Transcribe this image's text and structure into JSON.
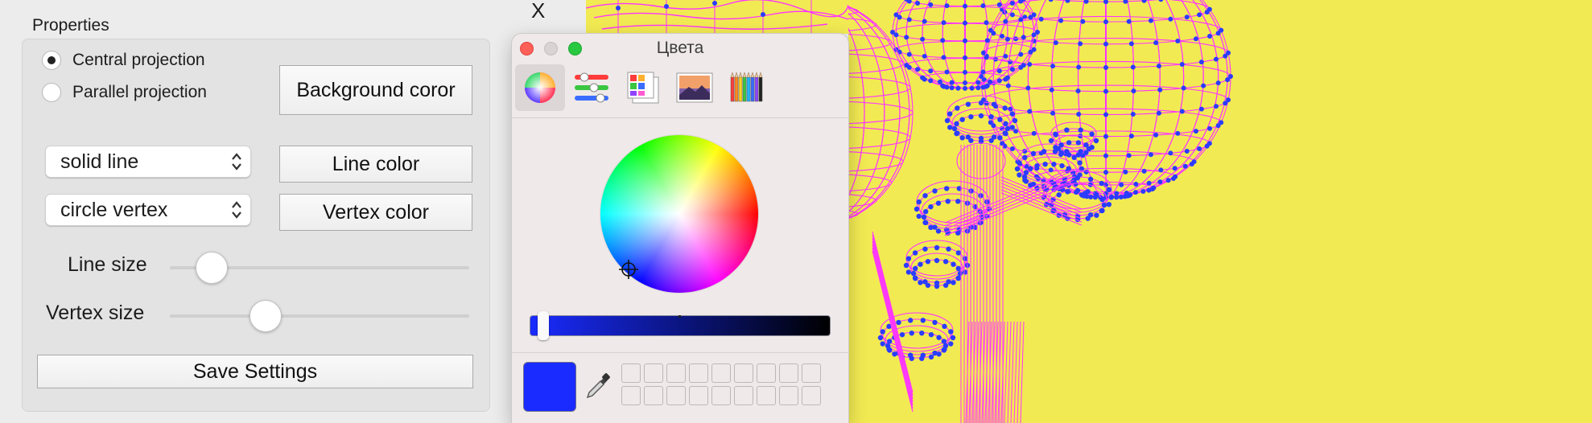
{
  "window": {
    "title": "Properties",
    "close_label": "X"
  },
  "projection": {
    "options": [
      {
        "label": "Central projection",
        "selected": true
      },
      {
        "label": "Parallel projection",
        "selected": false
      }
    ]
  },
  "buttons": {
    "background": "Background coror",
    "line_color": "Line color",
    "vertex_color": "Vertex color",
    "save": "Save Settings"
  },
  "combos": {
    "line_type": "solid line",
    "vertex_type": "circle vertex"
  },
  "sliders": {
    "line_size": {
      "label": "Line size",
      "value_fraction": 0.14
    },
    "vertex_size": {
      "label": "Vertex size",
      "value_fraction": 0.32
    }
  },
  "color_panel": {
    "title": "Цвета",
    "modes": [
      "color-wheel-icon",
      "color-sliders-icon",
      "color-palettes-icon",
      "image-palettes-icon",
      "pencils-icon"
    ],
    "current_color": "#1a2bff",
    "brightness_value": 0.04,
    "swatch_rows": 2,
    "swatch_cols": 9
  },
  "scene": {
    "background_color": "#f2ea52",
    "line_color": "#ff33ff",
    "vertex_color": "#2a3cff"
  }
}
